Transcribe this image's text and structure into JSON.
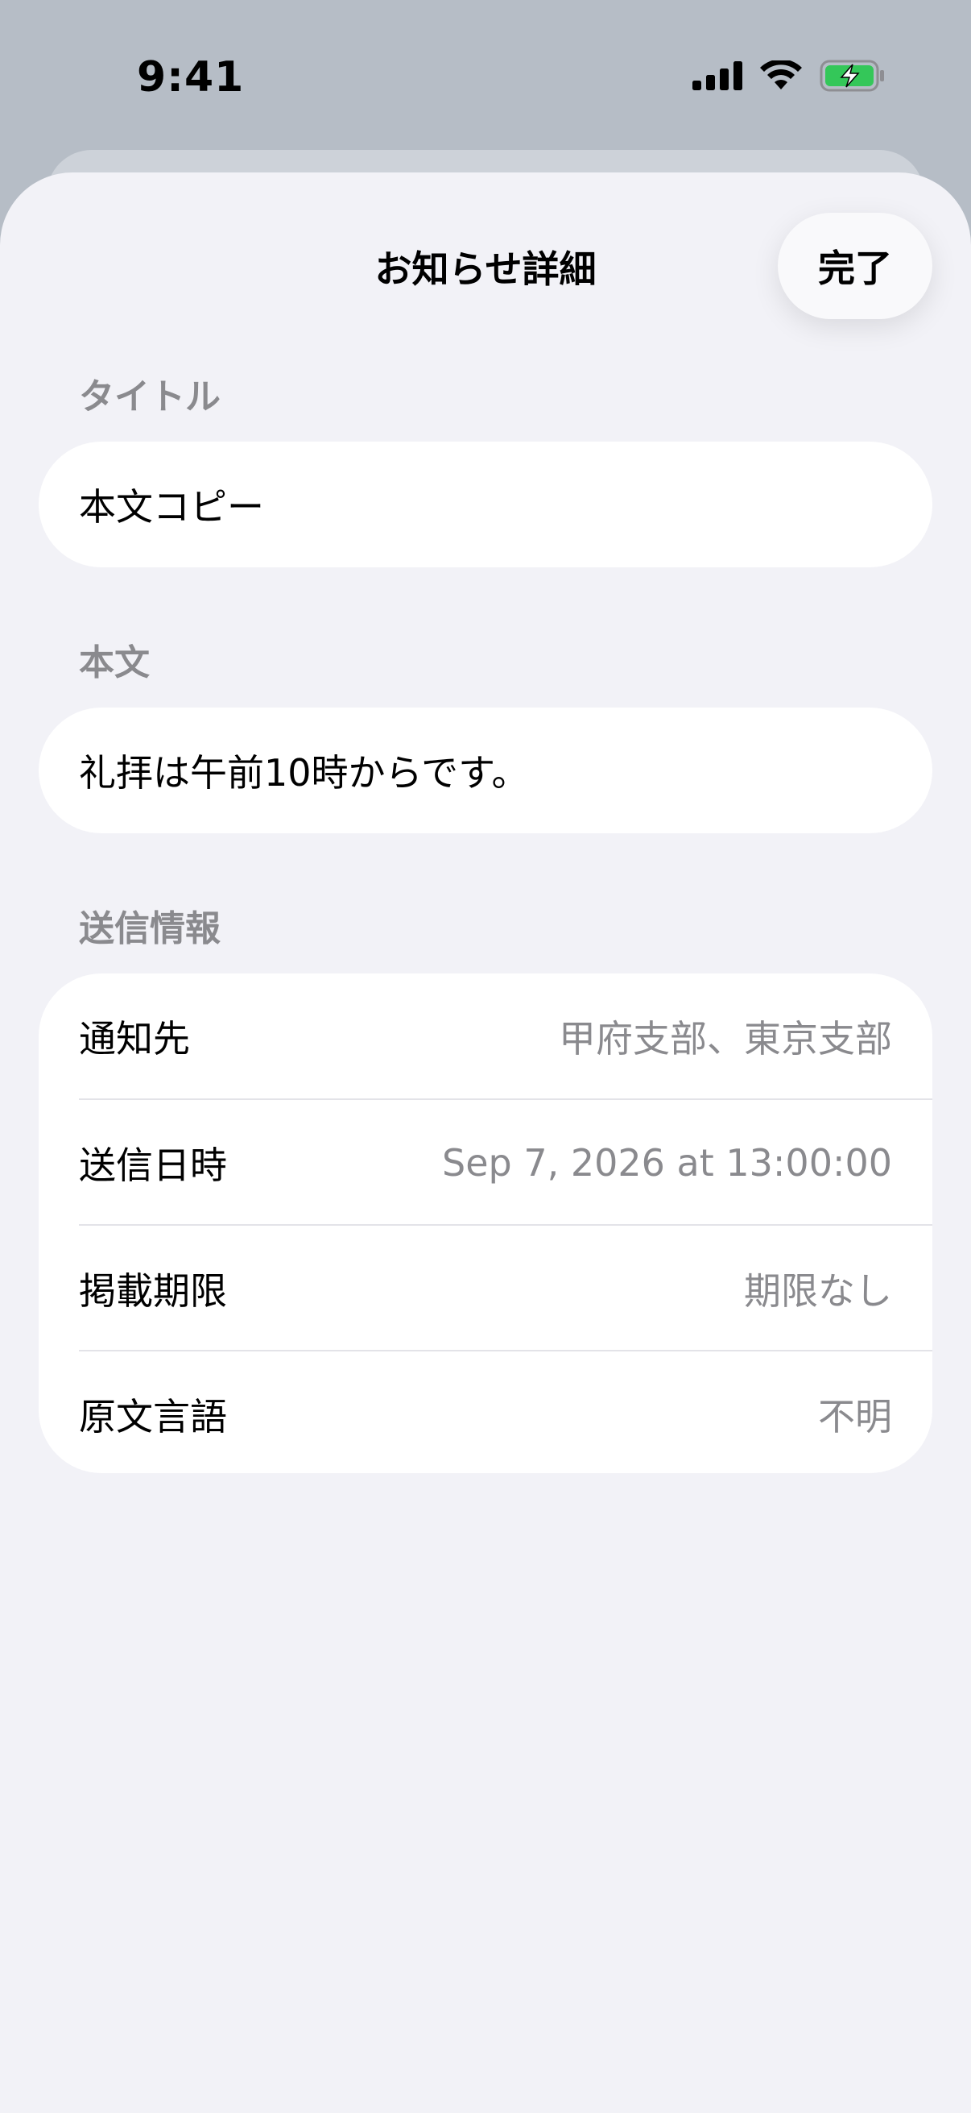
{
  "status_bar": {
    "time": "9:41",
    "icons": [
      "cellular-signal-icon",
      "wifi-icon",
      "battery-charging-icon"
    ],
    "battery_color": "#34c759"
  },
  "sheet": {
    "title": "お知らせ詳細",
    "done_label": "完了"
  },
  "fields": {
    "title_label": "タイトル",
    "title_value": "本文コピー",
    "body_label": "本文",
    "body_value": "礼拝は午前10時からです。"
  },
  "send_info": {
    "section_label": "送信情報",
    "rows": [
      {
        "key": "通知先",
        "value": "甲府支部、東京支部"
      },
      {
        "key": "送信日時",
        "value": "Sep 7, 2026 at 13:00:00"
      },
      {
        "key": "掲載期限",
        "value": "期限なし"
      },
      {
        "key": "原文言語",
        "value": "不明"
      }
    ]
  }
}
